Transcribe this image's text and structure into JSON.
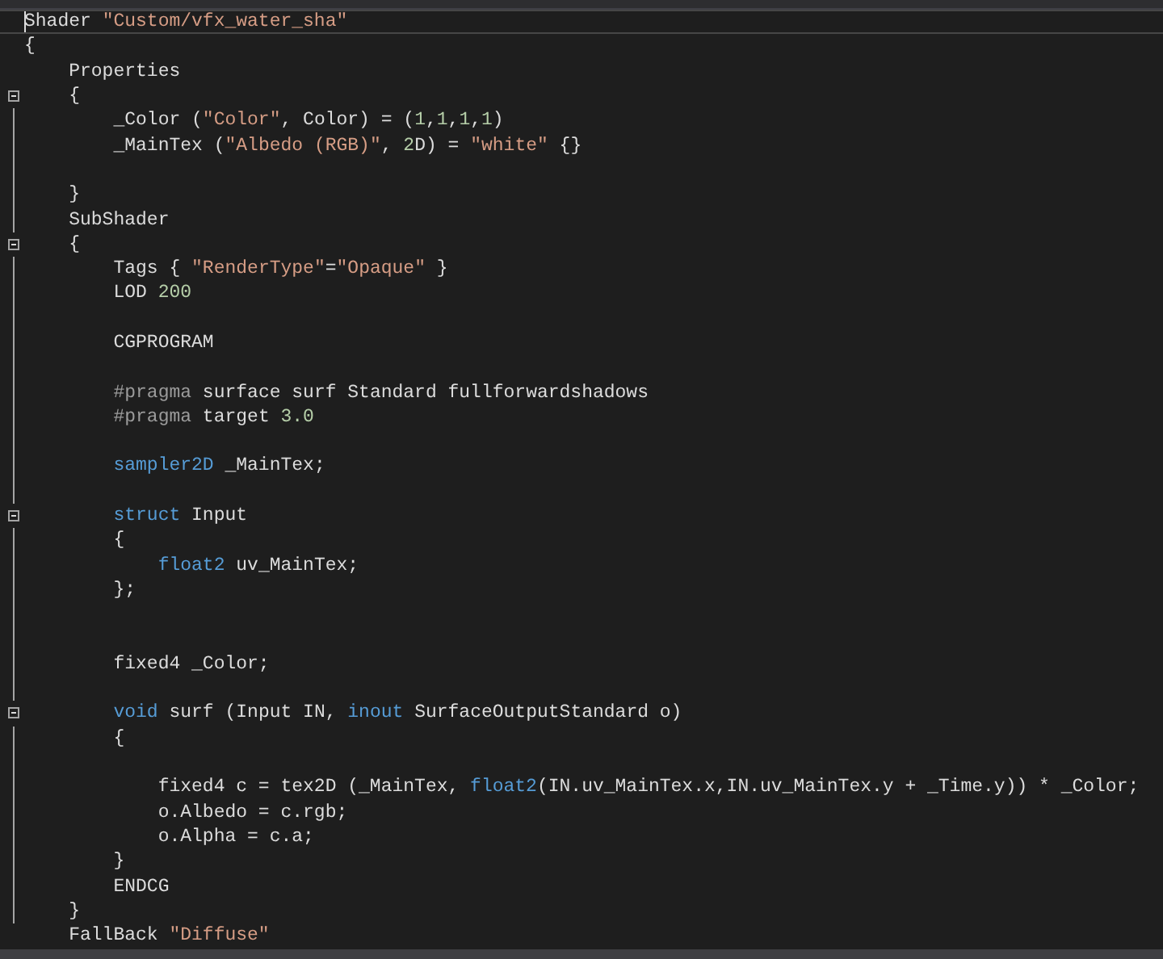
{
  "editor": {
    "lines": [
      {
        "fold": false,
        "current": true,
        "segments": [
          {
            "kind": "plain",
            "text": "Shader "
          },
          {
            "kind": "string",
            "text": "\"Custom/vfx_water_sha\""
          }
        ]
      },
      {
        "fold": false,
        "current": false,
        "segments": [
          {
            "kind": "plain",
            "text": "{"
          }
        ]
      },
      {
        "fold": false,
        "current": false,
        "segments": [
          {
            "kind": "plain",
            "text": "    Properties"
          }
        ]
      },
      {
        "fold": true,
        "current": false,
        "segments": [
          {
            "kind": "plain",
            "text": "    {"
          }
        ]
      },
      {
        "fold": false,
        "current": false,
        "segments": [
          {
            "kind": "plain",
            "text": "        _Color ("
          },
          {
            "kind": "string",
            "text": "\"Color\""
          },
          {
            "kind": "plain",
            "text": ", Color) = ("
          },
          {
            "kind": "number",
            "text": "1"
          },
          {
            "kind": "plain",
            "text": ","
          },
          {
            "kind": "number",
            "text": "1"
          },
          {
            "kind": "plain",
            "text": ","
          },
          {
            "kind": "number",
            "text": "1"
          },
          {
            "kind": "plain",
            "text": ","
          },
          {
            "kind": "number",
            "text": "1"
          },
          {
            "kind": "plain",
            "text": ")"
          }
        ]
      },
      {
        "fold": false,
        "current": false,
        "segments": [
          {
            "kind": "plain",
            "text": "        _MainTex ("
          },
          {
            "kind": "string",
            "text": "\"Albedo (RGB)\""
          },
          {
            "kind": "plain",
            "text": ", "
          },
          {
            "kind": "number",
            "text": "2"
          },
          {
            "kind": "plain",
            "text": "D) = "
          },
          {
            "kind": "string",
            "text": "\"white\""
          },
          {
            "kind": "plain",
            "text": " {}"
          }
        ]
      },
      {
        "fold": false,
        "current": false
      },
      {
        "fold": false,
        "current": false,
        "segments": [
          {
            "kind": "plain",
            "text": "    }"
          }
        ]
      },
      {
        "fold": false,
        "current": false,
        "segments": [
          {
            "kind": "plain",
            "text": "    SubShader"
          }
        ]
      },
      {
        "fold": true,
        "current": false,
        "segments": [
          {
            "kind": "plain",
            "text": "    {"
          }
        ]
      },
      {
        "fold": false,
        "current": false,
        "segments": [
          {
            "kind": "plain",
            "text": "        Tags { "
          },
          {
            "kind": "string",
            "text": "\"RenderType\""
          },
          {
            "kind": "plain",
            "text": "="
          },
          {
            "kind": "string",
            "text": "\"Opaque\""
          },
          {
            "kind": "plain",
            "text": " }"
          }
        ]
      },
      {
        "fold": false,
        "current": false,
        "segments": [
          {
            "kind": "plain",
            "text": "        LOD "
          },
          {
            "kind": "number",
            "text": "200"
          }
        ]
      },
      {
        "fold": false,
        "current": false
      },
      {
        "fold": false,
        "current": false,
        "segments": [
          {
            "kind": "plain",
            "text": "        CGPROGRAM"
          }
        ]
      },
      {
        "fold": false,
        "current": false
      },
      {
        "fold": false,
        "current": false,
        "segments": [
          {
            "kind": "preproc",
            "text": "        #pragma"
          },
          {
            "kind": "plain",
            "text": " surface surf Standard fullforwardshadows"
          }
        ]
      },
      {
        "fold": false,
        "current": false,
        "segments": [
          {
            "kind": "preproc",
            "text": "        #pragma"
          },
          {
            "kind": "plain",
            "text": " target "
          },
          {
            "kind": "number",
            "text": "3.0"
          }
        ]
      },
      {
        "fold": false,
        "current": false
      },
      {
        "fold": false,
        "current": false,
        "segments": [
          {
            "kind": "keyword",
            "text": "        sampler2D"
          },
          {
            "kind": "plain",
            "text": " _MainTex;"
          }
        ]
      },
      {
        "fold": false,
        "current": false
      },
      {
        "fold": true,
        "current": false,
        "segments": [
          {
            "kind": "keyword",
            "text": "        struct"
          },
          {
            "kind": "plain",
            "text": " Input"
          }
        ]
      },
      {
        "fold": false,
        "current": false,
        "segments": [
          {
            "kind": "plain",
            "text": "        {"
          }
        ]
      },
      {
        "fold": false,
        "current": false,
        "segments": [
          {
            "kind": "keyword",
            "text": "            float2"
          },
          {
            "kind": "plain",
            "text": " uv_MainTex;"
          }
        ]
      },
      {
        "fold": false,
        "current": false,
        "segments": [
          {
            "kind": "plain",
            "text": "        };"
          }
        ]
      },
      {
        "fold": false,
        "current": false
      },
      {
        "fold": false,
        "current": false
      },
      {
        "fold": false,
        "current": false,
        "segments": [
          {
            "kind": "plain",
            "text": "        fixed4 _Color;"
          }
        ]
      },
      {
        "fold": false,
        "current": false
      },
      {
        "fold": true,
        "current": false,
        "segments": [
          {
            "kind": "keyword",
            "text": "        void"
          },
          {
            "kind": "plain",
            "text": " surf (Input IN, "
          },
          {
            "kind": "keyword",
            "text": "inout"
          },
          {
            "kind": "plain",
            "text": " SurfaceOutputStandard o)"
          }
        ]
      },
      {
        "fold": false,
        "current": false,
        "segments": [
          {
            "kind": "plain",
            "text": "        {"
          }
        ]
      },
      {
        "fold": false,
        "current": false
      },
      {
        "fold": false,
        "current": false,
        "segments": [
          {
            "kind": "plain",
            "text": "            fixed4 c = tex2D (_MainTex, "
          },
          {
            "kind": "keyword",
            "text": "float2"
          },
          {
            "kind": "plain",
            "text": "(IN.uv_MainTex.x,IN.uv_MainTex.y + _Time.y)) * _Color;"
          }
        ]
      },
      {
        "fold": false,
        "current": false,
        "segments": [
          {
            "kind": "plain",
            "text": "            o.Albedo = c.rgb;"
          }
        ]
      },
      {
        "fold": false,
        "current": false,
        "segments": [
          {
            "kind": "plain",
            "text": "            o.Alpha = c.a;"
          }
        ]
      },
      {
        "fold": false,
        "current": false,
        "segments": [
          {
            "kind": "plain",
            "text": "        }"
          }
        ]
      },
      {
        "fold": false,
        "current": false,
        "segments": [
          {
            "kind": "plain",
            "text": "        ENDCG"
          }
        ]
      },
      {
        "fold": false,
        "current": false,
        "segments": [
          {
            "kind": "plain",
            "text": "    }"
          }
        ]
      },
      {
        "fold": false,
        "current": false,
        "segments": [
          {
            "kind": "plain",
            "text": "    FallBack "
          },
          {
            "kind": "string",
            "text": "\"Diffuse\""
          }
        ]
      }
    ]
  }
}
